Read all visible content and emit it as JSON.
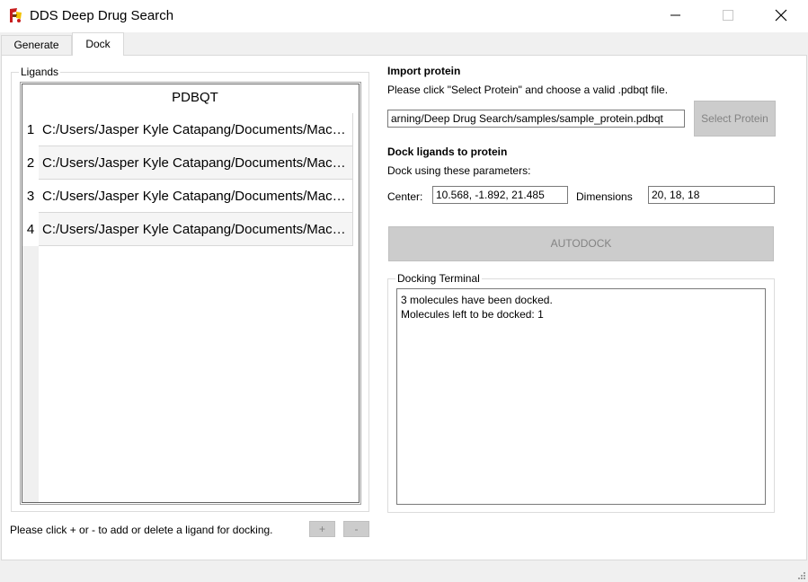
{
  "window": {
    "title": "DDS Deep Drug Search"
  },
  "tabs": [
    {
      "label": "Generate"
    },
    {
      "label": "Dock"
    }
  ],
  "ligands": {
    "group_title": "Ligands",
    "column_header": "PDBQT",
    "rows": [
      {
        "num": "1",
        "path": "C:/Users/Jasper Kyle Catapang/Documents/Machi..."
      },
      {
        "num": "2",
        "path": "C:/Users/Jasper Kyle Catapang/Documents/Machi..."
      },
      {
        "num": "3",
        "path": "C:/Users/Jasper Kyle Catapang/Documents/Machi..."
      },
      {
        "num": "4",
        "path": "C:/Users/Jasper Kyle Catapang/Documents/Machi..."
      }
    ],
    "hint": "Please click + or - to add or delete a ligand for docking.",
    "add_label": "+",
    "remove_label": "-"
  },
  "import_protein": {
    "heading": "Import protein",
    "instruction": "Please click \"Select Protein\" and choose a valid .pdbqt file.",
    "path_value": "arning/Deep Drug Search/samples/sample_protein.pdbqt",
    "select_label": "Select Protein"
  },
  "dock": {
    "heading": "Dock ligands to protein",
    "instruction": "Dock using these parameters:",
    "center_label": "Center:",
    "center_value": "10.568, -1.892, 21.485",
    "dimensions_label": "Dimensions",
    "dimensions_value": "20, 18, 18",
    "autodock_label": "AUTODOCK"
  },
  "terminal": {
    "group_title": "Docking Terminal",
    "lines": [
      "3 molecules have been docked.",
      "Molecules left to be docked: 1"
    ]
  },
  "icons": {
    "app": "dds-app-icon",
    "minimize": "minimize-icon",
    "maximize": "maximize-icon",
    "close": "close-icon",
    "resize": "resize-grip-icon"
  },
  "colors": {
    "disabled_button_bg": "#cccccc",
    "disabled_button_text": "#838383",
    "app_icon_red": "#c81e1e",
    "app_icon_yellow": "#f2c200"
  }
}
